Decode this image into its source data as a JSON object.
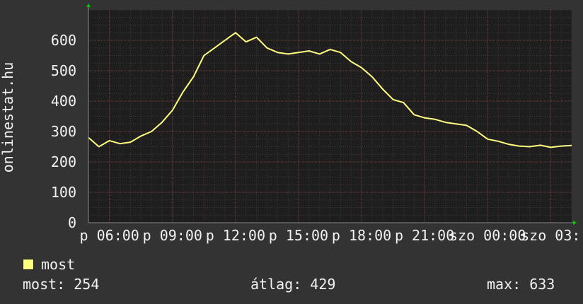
{
  "chart_data": {
    "type": "line",
    "ylabel": "onlinestat.hu",
    "ylim": [
      0,
      700
    ],
    "yticks": [
      0,
      100,
      200,
      300,
      400,
      500,
      600
    ],
    "xticks": [
      "p 06:00",
      "p 09:00",
      "p 12:00",
      "p 15:00",
      "p 18:00",
      "p 21:00",
      "szo 00:00",
      "szo 03:"
    ],
    "xtick_positions_hours": [
      6,
      9,
      12,
      15,
      18,
      21,
      24,
      27
    ],
    "xlim_hours": [
      5.0,
      28.0
    ],
    "grid": true,
    "series": [
      {
        "name": "most",
        "color": "#ffff80",
        "x_hours": [
          5.0,
          5.5,
          6.0,
          6.5,
          7.0,
          7.5,
          8.0,
          8.5,
          9.0,
          9.5,
          10.0,
          10.5,
          11.0,
          11.5,
          12.0,
          12.5,
          13.0,
          13.5,
          14.0,
          14.5,
          15.0,
          15.5,
          16.0,
          16.5,
          17.0,
          17.5,
          18.0,
          18.5,
          19.0,
          19.5,
          20.0,
          20.5,
          21.0,
          21.5,
          22.0,
          22.5,
          23.0,
          23.5,
          24.0,
          24.5,
          25.0,
          25.5,
          26.0,
          26.5,
          27.0,
          27.5,
          28.0
        ],
        "values": [
          280,
          250,
          270,
          260,
          265,
          285,
          300,
          330,
          370,
          430,
          480,
          550,
          575,
          600,
          625,
          595,
          610,
          575,
          560,
          555,
          560,
          565,
          555,
          570,
          560,
          530,
          510,
          480,
          440,
          405,
          395,
          355,
          345,
          340,
          330,
          325,
          320,
          300,
          275,
          268,
          258,
          252,
          250,
          255,
          248,
          252,
          254
        ]
      }
    ]
  },
  "legend": {
    "label": "most",
    "color": "#ffff80"
  },
  "stats": {
    "current": "most: 254",
    "average": "átlag: 429",
    "max": "max: 633"
  },
  "colors": {
    "background": "#333333",
    "plot_background": "#1e1e1e",
    "grid": "#3c3c3c",
    "grid_minor": "#5a2e2e",
    "axis_arrow": "#00cc00",
    "text": "#f2f2f2"
  }
}
